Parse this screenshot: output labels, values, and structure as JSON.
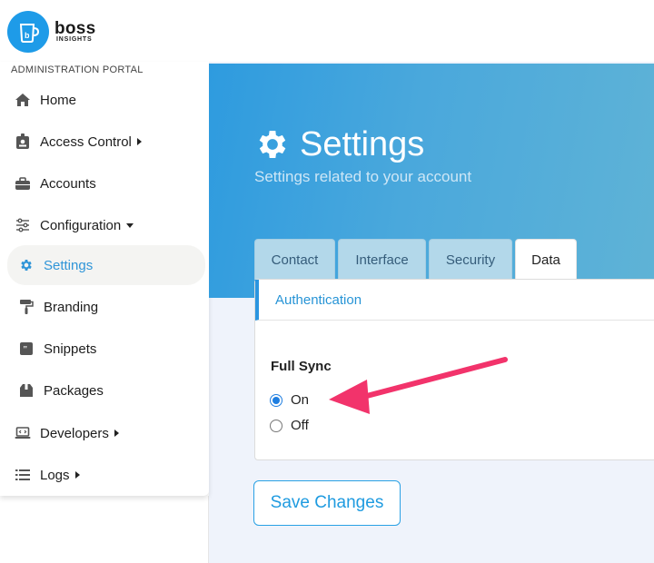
{
  "brand": {
    "name": "boss",
    "tagline": "INSIGHTS",
    "logo_color": "#1e9be8"
  },
  "sidebar": {
    "portal_label": "ADMINISTRATION PORTAL",
    "items": [
      {
        "label": "Home",
        "icon": "home-icon"
      },
      {
        "label": "Access Control",
        "icon": "id-badge-icon",
        "caret": "right"
      },
      {
        "label": "Accounts",
        "icon": "briefcase-icon"
      },
      {
        "label": "Configuration",
        "icon": "sliders-icon",
        "caret": "down"
      },
      {
        "label": "Settings",
        "icon": "gear-icon",
        "active": true
      },
      {
        "label": "Branding",
        "icon": "paint-roller-icon"
      },
      {
        "label": "Snippets",
        "icon": "quote-icon"
      },
      {
        "label": "Packages",
        "icon": "box-icon"
      },
      {
        "label": "Developers",
        "icon": "laptop-code-icon",
        "caret": "right"
      },
      {
        "label": "Logs",
        "icon": "list-icon",
        "caret": "right"
      }
    ]
  },
  "header": {
    "title": "Settings",
    "subtitle": "Settings related to your account"
  },
  "tabs": [
    {
      "label": "Contact"
    },
    {
      "label": "Interface"
    },
    {
      "label": "Security"
    },
    {
      "label": "Data",
      "active": true
    }
  ],
  "panel": {
    "subtab_label": "Authentication",
    "field_label": "Full Sync",
    "options": [
      {
        "label": "On",
        "checked": true
      },
      {
        "label": "Off",
        "checked": false
      }
    ]
  },
  "actions": {
    "save_label": "Save Changes"
  },
  "colors": {
    "accent": "#2f95d8",
    "annotation_arrow": "#f2336b"
  }
}
